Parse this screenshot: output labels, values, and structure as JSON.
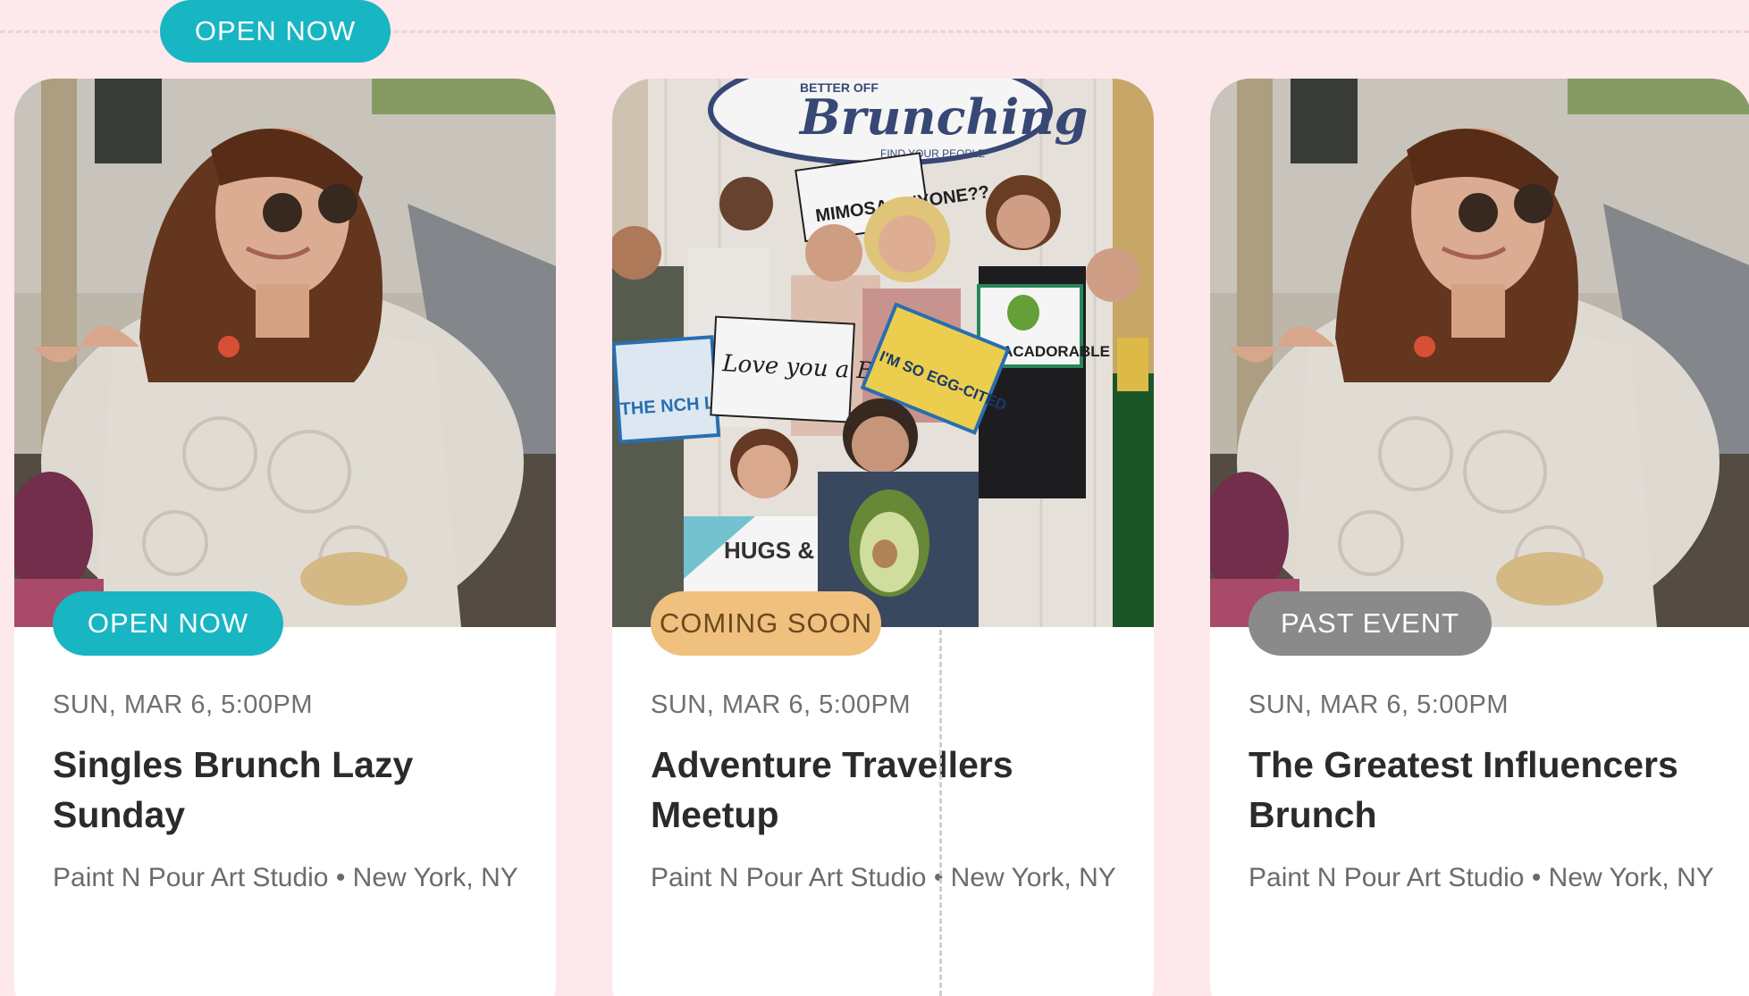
{
  "top_badge": "OPEN NOW",
  "events": [
    {
      "status": "OPEN NOW",
      "date": "SUN, MAR 6, 5:00PM",
      "title": "Singles Brunch  Lazy Sunday",
      "location": "Paint N Pour Art Studio • New York, NY",
      "image": "woman-brunch-photo"
    },
    {
      "status": "COMING SOON",
      "date": "SUN, MAR 6, 5:00PM",
      "title": "Adventure Travellers Meetup",
      "location": "Paint N Pour Art Studio • New York, NY",
      "image": "group-photo-booth",
      "photo_text": {
        "logo_top": "BETTER OFF",
        "logo_main": "Brunching",
        "logo_sub": "FIND YOUR PEOPLE",
        "sign_mimosa": "MIMOSA ANYONE??",
        "sign_love": "Love you a Brunch",
        "sign_life": "THE NCH LIFE ME",
        "sign_egg": "I'M SO EGG-CITED",
        "sign_avocado": "AVACADORABLE",
        "sign_hugs": "HUGS &"
      }
    },
    {
      "status": "PAST EVENT",
      "date": "SUN, MAR 6, 5:00PM",
      "title": "The Greatest Influencers Brunch",
      "location": "Paint N Pour Art Studio • New York, NY",
      "image": "woman-brunch-photo"
    }
  ],
  "colors": {
    "background": "#fde8ec",
    "open": "#18b5c3",
    "coming_soon": "#f0c07e",
    "past": "#8a8a8a"
  }
}
